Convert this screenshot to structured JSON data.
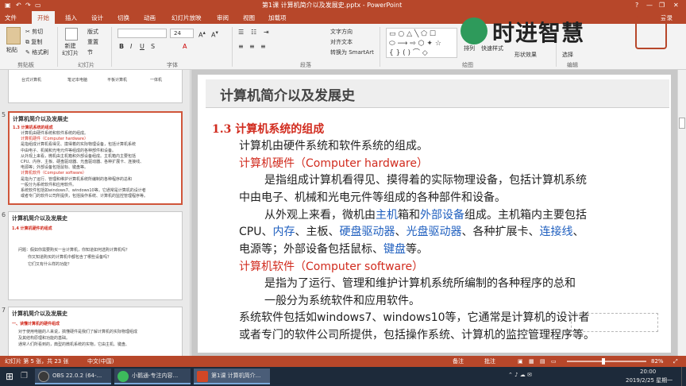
{
  "window": {
    "title": "第1课 计算机简介以及发展史.pptx - PowerPoint",
    "login": "登录"
  },
  "tabs": [
    "文件",
    "开始",
    "插入",
    "设计",
    "切换",
    "动画",
    "幻灯片放映",
    "审阅",
    "视图",
    "加载项"
  ],
  "ribbon": {
    "paste": "粘贴",
    "cut": "剪切",
    "copy": "复制",
    "format_painter": "格式刷",
    "new_slide": "新建\n幻灯片",
    "layout": "版式",
    "reset": "重置",
    "section": "节",
    "font_size": "24",
    "text_direction": "文字方向",
    "align_text": "对齐文本",
    "smartart": "转换为 SmartArt",
    "arrange": "排列",
    "quick_styles": "快速样式",
    "shape_effects": "形状效果",
    "select": "选择",
    "groups": [
      "剪贴板",
      "幻灯片",
      "字体",
      "段落",
      "绘图",
      "编辑"
    ]
  },
  "logo": {
    "text": "时进智慧"
  },
  "thumbnails": {
    "prev_tail": [
      "台式计算机",
      "笔记本电脑",
      "平板计算机",
      "一体机"
    ],
    "slide5": {
      "num": "5",
      "title": "计算机简介以及发展史",
      "heading": "1.3 计算机系统的组成",
      "lines": [
        "计算机由硬件系统和软件系统的组成。",
        "计算机硬件（Computer hardware）",
        "是指组成计算机看得见、摸得着的实际物理设备，包括计算机系统",
        "中由电子、机械和光电元件等组成的各种部件和设备。",
        "从外观上来看，微机由主机箱和外部设备组成。主机箱内主要包括",
        "CPU、内存、主板、硬盘驱动器、光盘驱动器、各种扩展卡、连接线、",
        "电源等；外部设备包括鼠标、键盘等。",
        "计算机软件（Computer software）",
        "是指为了运行、管理和维护计算机系统所编制的各种程序的总和",
        "一般分为系统软件和应用软件。",
        "系统软件包括如windows7、windows10等，它通常是计算机的设计者",
        "或者专门的软件公司所提供，包括操作系统、计算机的监控管理程序等。"
      ]
    },
    "slide6": {
      "num": "6",
      "title": "计算机简介以及发展史",
      "heading": "1.4 计算机硬件的组成",
      "lines": [
        "问题：假如你需要购买一台计算机，你知道如何选购计算机吗？",
        "你又知道购买的计算机中都包含了哪些设备吗？",
        "它们又有什么样的功能？"
      ]
    },
    "slide7": {
      "num": "7",
      "title": "计算机简介以及发展史",
      "heading": "一、读懂计算机的硬件组成",
      "lines": [
        "对于使用电脑的人来说，搞懂硬件是我们了解计算机的实际物理组成",
        "及其结构原理和功能的基础。",
        "通常人们所看到的，典型的微机系统的实物，它由主机、键盘、"
      ]
    }
  },
  "slide": {
    "title": "计算机简介以及发展史",
    "heading": "1.3  计算机系统的组成",
    "intro": "计算机由硬件系统和软件系统的组成。",
    "hw_title": "计算机硬件（Computer hardware）",
    "hw_l1": "是指组成计算机看得见、摸得着的实际物理设备，包括计算机系统",
    "hw_l2": "中由电子、机械和光电元件等组成的各种部件和设备。",
    "p3_a": "从外观上来看，微机由",
    "p3_b": "主机",
    "p3_c": "箱和",
    "p3_d": "外部设备",
    "p3_e": "组成。主机箱内主要包括",
    "p4_a": "CPU、",
    "p4_b": "内存",
    "p4_c": "、主板、",
    "p4_d": "硬盘驱动器",
    "p4_e": "、",
    "p4_f": "光盘驱动器",
    "p4_g": "、各种扩展卡、",
    "p4_h": "连接线",
    "p4_i": "、",
    "p5_a": "电源等；外部设备包括鼠标、",
    "p5_b": "键盘",
    "p5_c": "等。",
    "sw_title": "计算机软件（Computer software）",
    "sw_l1": "是指为了运行、管理和维护计算机系统所编制的各种程序的总和",
    "sw_l2": "一般分为系统软件和应用软件。",
    "sys_l1": "系统软件包括如windows7、windows10等，它通常是计算机的设计者",
    "sys_l2": "或者专门的软件公司所提供，包括操作系统、计算机的监控管理程序等。"
  },
  "status": {
    "slide_info": "幻灯片 第 5 张，共 23 张",
    "language": "中文(中国)",
    "notes": "备注",
    "comments": "批注",
    "zoom": "82%"
  },
  "taskbar": {
    "apps": [
      "OBS 22.0.2 (64-...",
      "小鹅通-专注内容...",
      "第1课 计算机简介..."
    ],
    "time": "20:00",
    "date": "2019/2/25 星期一"
  },
  "colors": {
    "accent": "#b7472a",
    "heading_red": "#d12b1e",
    "link_blue": "#1f5fbf"
  }
}
